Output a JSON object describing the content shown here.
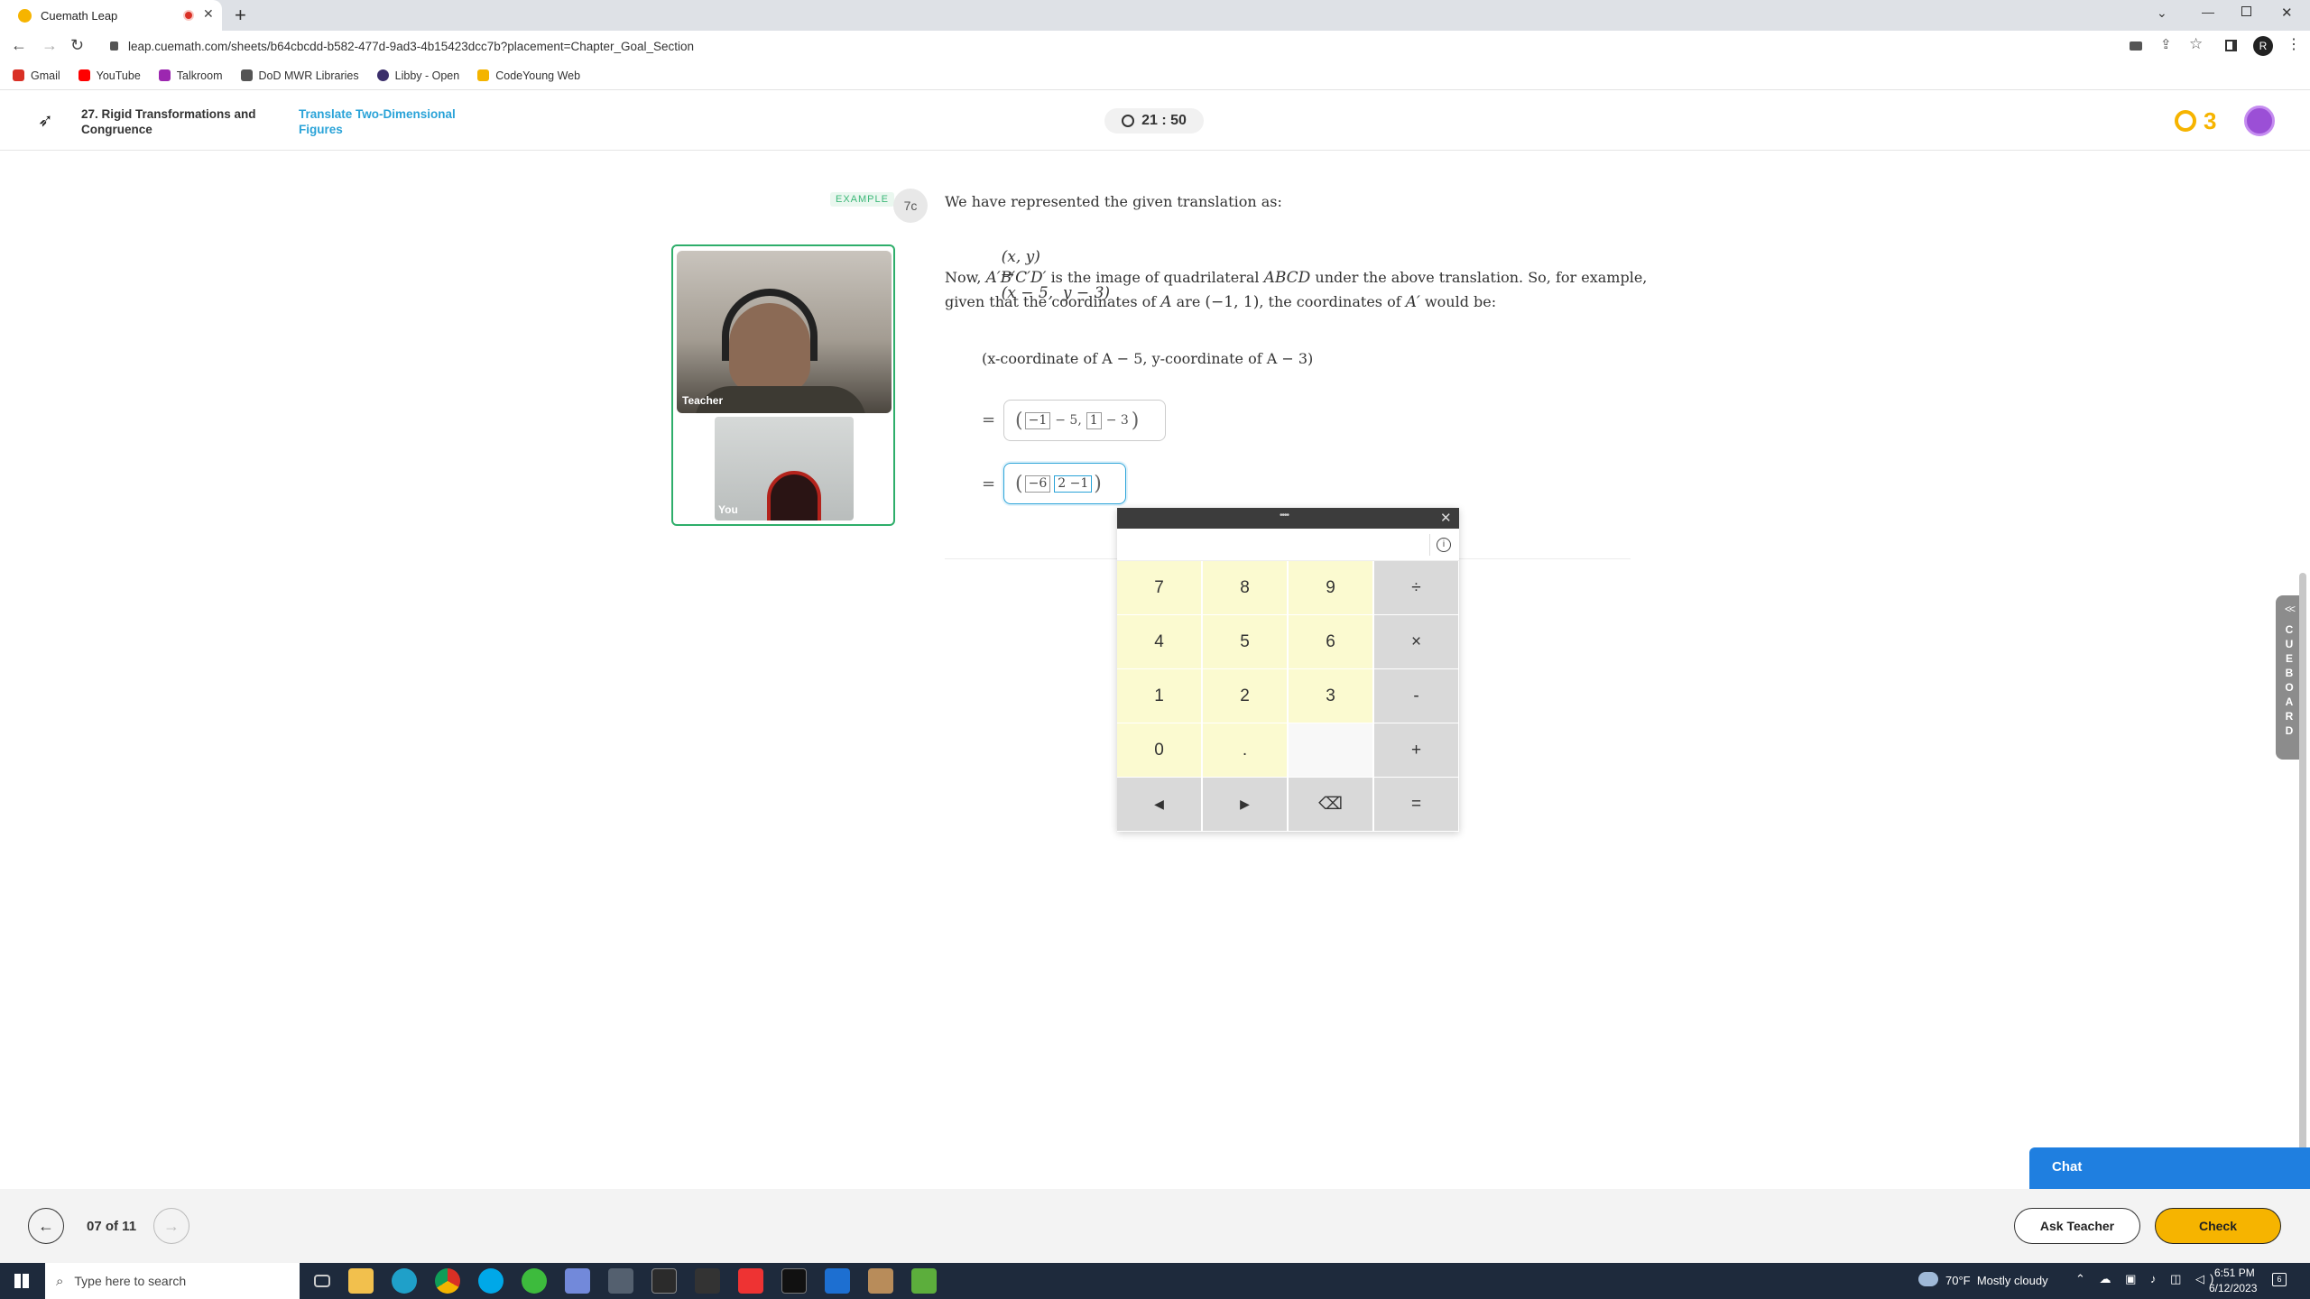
{
  "browser": {
    "tab_title": "Cuemath Leap",
    "url": "leap.cuemath.com/sheets/b64cbcdd-b582-477d-9ad3-4b15423dcc7b?placement=Chapter_Goal_Section",
    "bookmarks": [
      {
        "label": "Gmail",
        "color": "#d93025"
      },
      {
        "label": "YouTube",
        "color": "#ff0000"
      },
      {
        "label": "Talkroom",
        "color": "#9c27b0"
      },
      {
        "label": "DoD MWR Libraries",
        "color": "#555555"
      },
      {
        "label": "Libby - Open",
        "color": "#3b2f6b"
      },
      {
        "label": "CodeYoung Web",
        "color": "#f4b400"
      }
    ]
  },
  "header": {
    "chapter": "27. Rigid Transformations and Congruence",
    "topic": "Translate Two-Dimensional Figures",
    "timer": "21 : 50",
    "streak": "3"
  },
  "video": {
    "teacher_label": "Teacher",
    "you_label": "You"
  },
  "lesson": {
    "tag": "EXAMPLE",
    "number": "7c",
    "intro": "We have represented the given translation as:",
    "rule_lhs": "(x, y)",
    "arrow": "→",
    "rule_rhs": "(x − 5,  y − 3)",
    "p2_now": "Now,",
    "p2_image": "A′B′C′D′",
    "p2_mid": "is the image of quadrilateral",
    "p2_quad": "ABCD",
    "p2_tail": "under the above translation. So, for example,",
    "p3_given": "given that the coordinates of",
    "p3_a": "A",
    "p3_are": "are",
    "p3_coords": "(−1, 1)",
    "p3_mid": ", the coordinates of",
    "p3_aprime": "A′",
    "p3_tail": "would be:",
    "coord_line": "(x-coordinate of A − 5, y-coordinate of A − 3)",
    "eq1": {
      "equals": "=",
      "box1": "−1",
      "minus5": "− 5,",
      "box2": "1",
      "minus3": "− 3"
    },
    "eq2": {
      "equals": "=",
      "box1": "−6",
      "box2": "2 −1"
    }
  },
  "calculator": {
    "drag_handle": "••••",
    "close": "✕",
    "info": "i",
    "display": "",
    "keys": [
      "7",
      "8",
      "9",
      "÷",
      "4",
      "5",
      "6",
      "×",
      "1",
      "2",
      "3",
      "-",
      "0",
      ".",
      "",
      "+",
      "◀",
      "▶",
      "⌫",
      "="
    ]
  },
  "cueboard": {
    "chevron": "<<",
    "label": "CUEBOARD"
  },
  "chat": {
    "label": "Chat"
  },
  "footer": {
    "progress": "07 of 11",
    "ask_teacher": "Ask Teacher",
    "check": "Check"
  },
  "taskbar": {
    "search_placeholder": "Type here to search",
    "weather": "70°F  Mostly cloudy",
    "time": "6:51 PM",
    "date": "6/12/2023",
    "notifications": "6"
  }
}
